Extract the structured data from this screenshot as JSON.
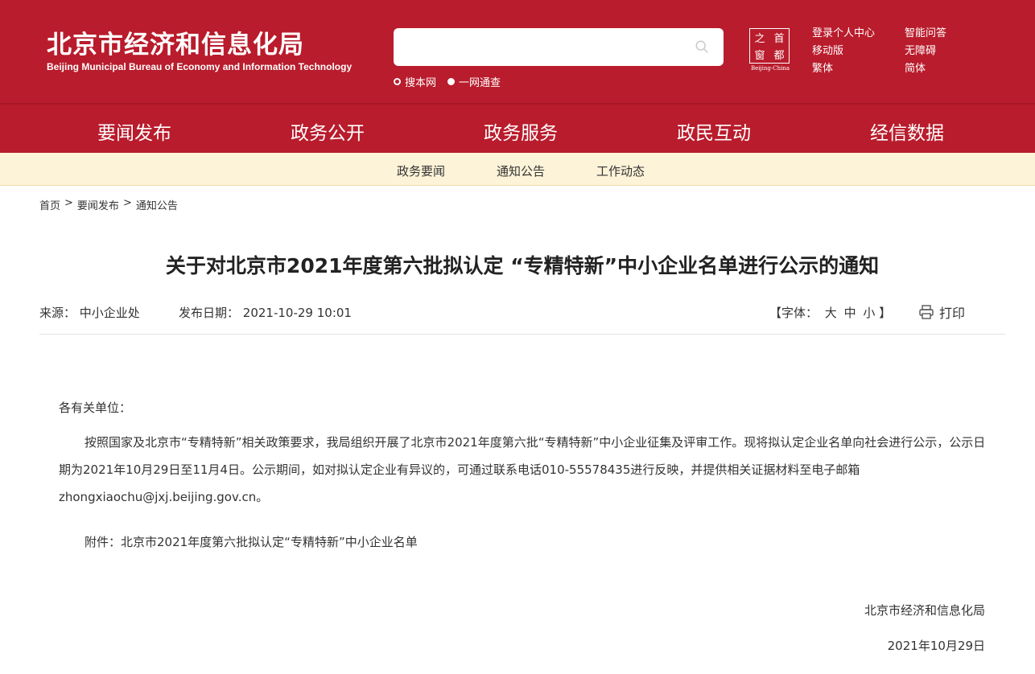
{
  "header": {
    "logo_cn": "北京市经济和信息化局",
    "logo_en": "Beijing Municipal Bureau of Economy and Information Technology",
    "search": {
      "placeholder": "",
      "options": [
        "搜本网",
        "一网通查"
      ]
    },
    "seal": {
      "chars": [
        "之",
        "首",
        "窗",
        "都"
      ],
      "caption": "Beijing-China"
    },
    "quick_links": [
      "登录个人中心",
      "智能问答",
      "移动版",
      "无障碍",
      "繁体",
      "简体"
    ]
  },
  "nav": {
    "items": [
      "要闻发布",
      "政务公开",
      "政务服务",
      "政民互动",
      "经信数据"
    ],
    "active": "要闻发布"
  },
  "subnav": {
    "items": [
      "政务要闻",
      "通知公告",
      "工作动态"
    ]
  },
  "breadcrumb": [
    "首页",
    ">",
    "要闻发布",
    ">",
    "通知公告"
  ],
  "article": {
    "title": "关于对北京市2021年度第六批拟认定 “专精特新”中小企业名单进行公示的通知",
    "source_label": "来源：",
    "source": "中小企业处",
    "date_label": "发布日期：",
    "date": "2021-10-29 10:01",
    "font_label": "【字体：",
    "font_sizes": [
      "大",
      "中",
      "小"
    ],
    "font_close": "】",
    "print_label": "打印",
    "salutation": "各有关单位：",
    "body": "按照国家及北京市“专精特新”相关政策要求，我局组织开展了北京市2021年度第六批“专精特新”中小企业征集及评审工作。现将拟认定企业名单向社会进行公示，公示日期为2021年10月29日至11月4日。公示期间，如对拟认定企业有异议的，可通过联系电话010-55578435进行反映，并提供相关证据材料至电子邮箱zhongxiaochu@jxj.beijing.gov.cn。",
    "attachment": "附件：北京市2021年度第六批拟认定“专精特新”中小企业名单",
    "signature": "北京市经济和信息化局",
    "sign_date": "2021年10月29日"
  },
  "colors": {
    "header_red": "#b91c2c",
    "subnav_bg": "#fdf3d8",
    "active_underline": "#f3d49a"
  }
}
